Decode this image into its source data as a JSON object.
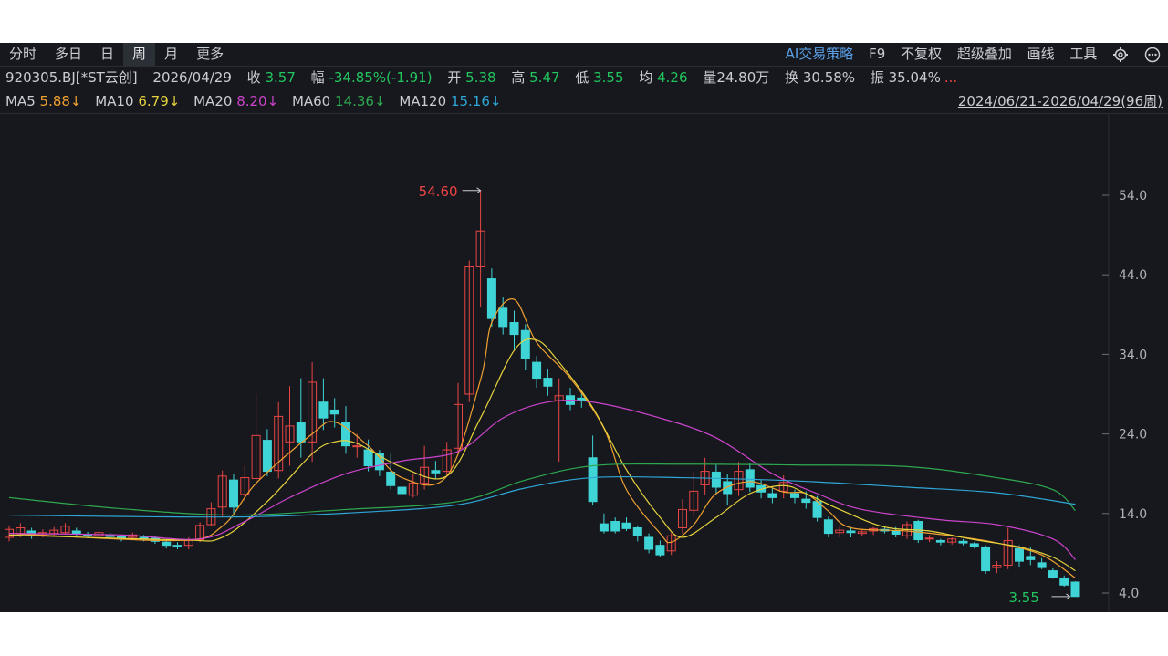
{
  "tabs": [
    "分时",
    "多日",
    "日",
    "周",
    "月",
    "更多"
  ],
  "active_tab": "周",
  "tools": {
    "ai": "AI交易策略",
    "f9": "F9",
    "fq": "不复权",
    "overlay": "超级叠加",
    "draw": "画线",
    "toolbox": "工具",
    "settings_icon": "gear-icon",
    "more_icon": "more-icon"
  },
  "stock": {
    "code": "920305.BJ[*ST云创]",
    "date": "2026/04/29",
    "close_label": "收",
    "close": "3.57",
    "chg_label": "幅",
    "chg": "-34.85%(-1.91)",
    "open_label": "开",
    "open": "5.38",
    "high_label": "高",
    "high": "5.47",
    "low_label": "低",
    "low": "3.55",
    "avg_label": "均",
    "avg": "4.26",
    "vol_label": "量",
    "vol": "24.80万",
    "turnover_label": "换",
    "turnover": "30.58%",
    "amp_label": "振",
    "amp": "35.04%",
    "more": "..."
  },
  "ma_bar": {
    "ma5_label": "MA5",
    "ma5": "5.88↓",
    "ma10_label": "MA10",
    "ma10": "6.79↓",
    "ma20_label": "MA20",
    "ma20": "8.20↓",
    "ma60_label": "MA60",
    "ma60": "14.36↓",
    "ma120_label": "MA120",
    "ma120": "15.16↓",
    "range": "2024/06/21-2026/04/29(96周)"
  },
  "colors": {
    "up": "#e84545",
    "down": "#3fd4d6",
    "ma5": "#f0a030",
    "ma10": "#e6d23c",
    "ma20": "#cc44cc",
    "ma60": "#2fa84f",
    "ma120": "#2fa6d6"
  },
  "chart_data": {
    "type": "candlestick",
    "ylim": [
      4.0,
      54.0
    ],
    "yticks": [
      "54.0",
      "44.0",
      "34.0",
      "24.0",
      "14.0",
      "4.0"
    ],
    "annotations": {
      "high": "54.60",
      "low": "3.55"
    },
    "candles": [
      [
        11.0,
        12.0,
        10.5,
        12.5
      ],
      [
        11.5,
        12.2,
        11.0,
        12.8
      ],
      [
        11.8,
        11.2,
        10.8,
        12.2
      ],
      [
        11.3,
        11.6,
        11.0,
        12.0
      ],
      [
        11.5,
        11.9,
        11.2,
        12.3
      ],
      [
        11.6,
        12.4,
        11.4,
        12.8
      ],
      [
        11.8,
        11.4,
        11.1,
        12.2
      ],
      [
        11.4,
        11.2,
        10.9,
        11.7
      ],
      [
        11.2,
        11.6,
        11.0,
        11.9
      ],
      [
        11.3,
        11.1,
        10.8,
        11.6
      ],
      [
        11.1,
        10.9,
        10.5,
        11.3
      ],
      [
        11.0,
        11.3,
        10.7,
        11.6
      ],
      [
        11.0,
        10.8,
        10.5,
        11.3
      ],
      [
        10.9,
        10.5,
        10.2,
        11.2
      ],
      [
        10.4,
        10.0,
        9.6,
        10.7
      ],
      [
        10.0,
        9.8,
        9.5,
        10.4
      ],
      [
        10.0,
        10.6,
        9.5,
        11.0
      ],
      [
        10.7,
        12.5,
        10.4,
        12.9
      ],
      [
        12.6,
        14.6,
        12.4,
        15.4
      ],
      [
        14.8,
        18.7,
        13.6,
        19.4
      ],
      [
        18.2,
        14.8,
        14.0,
        19.0
      ],
      [
        16.4,
        18.5,
        15.5,
        20.0
      ],
      [
        18.4,
        23.8,
        17.5,
        29.0
      ],
      [
        23.2,
        19.3,
        18.7,
        24.6
      ],
      [
        19.4,
        26.2,
        18.4,
        28.0
      ],
      [
        23.0,
        25.0,
        20.0,
        30.0
      ],
      [
        25.5,
        23.0,
        21.0,
        31.0
      ],
      [
        23.0,
        30.5,
        20.5,
        33.0
      ],
      [
        28.0,
        26.0,
        24.5,
        31.0
      ],
      [
        27.0,
        26.5,
        24.8,
        28.5
      ],
      [
        25.5,
        22.5,
        21.5,
        27.5
      ],
      [
        22.5,
        22.5,
        21.0,
        24.0
      ],
      [
        22.0,
        20.0,
        19.3,
        23.3
      ],
      [
        21.5,
        19.5,
        18.7,
        22.0
      ],
      [
        19.2,
        17.5,
        17.0,
        21.5
      ],
      [
        17.3,
        16.5,
        16.0,
        17.8
      ],
      [
        16.3,
        17.8,
        16.0,
        19.0
      ],
      [
        17.8,
        19.8,
        17.0,
        22.5
      ],
      [
        19.4,
        19.1,
        18.3,
        20.6
      ],
      [
        19.3,
        22.0,
        18.8,
        23.0
      ],
      [
        22.2,
        27.7,
        21.6,
        30.4
      ],
      [
        29.0,
        45.0,
        28.0,
        45.8
      ],
      [
        45.0,
        49.5,
        40.0,
        54.6
      ],
      [
        43.5,
        38.5,
        37.5,
        44.8
      ],
      [
        39.8,
        37.5,
        36.5,
        41.2
      ],
      [
        38.0,
        36.5,
        34.5,
        39.5
      ],
      [
        37.0,
        33.5,
        32.0,
        37.8
      ],
      [
        33.0,
        31.0,
        29.8,
        33.8
      ],
      [
        31.0,
        30.0,
        28.8,
        32.2
      ],
      [
        28.2,
        28.8,
        20.5,
        31.0
      ],
      [
        28.8,
        27.7,
        27.0,
        29.8
      ],
      [
        28.5,
        28.2,
        27.3,
        29.5
      ],
      [
        21.0,
        15.5,
        15.0,
        23.8
      ],
      [
        12.7,
        11.8,
        11.5,
        14.0
      ],
      [
        13.0,
        11.8,
        11.5,
        13.5
      ],
      [
        12.8,
        12.1,
        11.8,
        13.5
      ],
      [
        12.2,
        11.2,
        10.5,
        12.5
      ],
      [
        11.0,
        9.5,
        9.0,
        11.5
      ],
      [
        10.0,
        8.8,
        8.5,
        10.6
      ],
      [
        9.3,
        11.2,
        8.8,
        11.6
      ],
      [
        12.2,
        14.5,
        11.5,
        15.8
      ],
      [
        14.4,
        16.8,
        13.5,
        19.2
      ],
      [
        17.6,
        19.3,
        16.4,
        21.0
      ],
      [
        19.2,
        17.3,
        16.4,
        20.1
      ],
      [
        18.0,
        16.5,
        15.0,
        19.0
      ],
      [
        17.0,
        19.3,
        16.2,
        20.5
      ],
      [
        19.5,
        17.3,
        16.7,
        20.4
      ],
      [
        17.5,
        16.7,
        15.9,
        18.2
      ],
      [
        16.5,
        16.0,
        15.3,
        17.2
      ],
      [
        16.8,
        17.9,
        15.9,
        18.8
      ],
      [
        16.5,
        16.0,
        15.3,
        17.0
      ],
      [
        15.8,
        15.4,
        14.6,
        16.8
      ],
      [
        15.5,
        13.5,
        13.0,
        16.2
      ],
      [
        13.2,
        11.5,
        11.0,
        13.6
      ],
      [
        11.6,
        11.9,
        11.0,
        12.4
      ],
      [
        11.8,
        11.6,
        11.0,
        12.3
      ],
      [
        11.5,
        11.7,
        11.2,
        12.0
      ],
      [
        11.8,
        12.1,
        11.3,
        12.3
      ],
      [
        12.0,
        11.8,
        11.5,
        12.3
      ],
      [
        11.8,
        11.4,
        11.0,
        12.3
      ],
      [
        11.2,
        12.6,
        10.8,
        13.0
      ],
      [
        13.0,
        10.7,
        10.3,
        13.2
      ],
      [
        10.8,
        10.9,
        10.4,
        11.3
      ],
      [
        10.6,
        10.4,
        10.0,
        10.8
      ],
      [
        10.4,
        10.8,
        10.1,
        11.0
      ],
      [
        10.5,
        10.3,
        10.0,
        10.8
      ],
      [
        10.2,
        9.9,
        9.6,
        10.4
      ],
      [
        9.8,
        6.8,
        6.4,
        10.0
      ],
      [
        7.2,
        7.5,
        6.5,
        8.0
      ],
      [
        7.5,
        10.6,
        7.0,
        12.2
      ],
      [
        9.6,
        8.0,
        7.3,
        10.0
      ],
      [
        8.6,
        8.2,
        7.5,
        9.8
      ],
      [
        7.8,
        7.2,
        7.0,
        8.4
      ],
      [
        6.8,
        6.0,
        5.8,
        7.1
      ],
      [
        5.8,
        5.0,
        4.8,
        6.2
      ],
      [
        5.38,
        3.57,
        3.55,
        5.47
      ]
    ],
    "series": [
      {
        "name": "MA5",
        "anchors": [
          [
            0,
            11.5
          ],
          [
            15,
            10.6
          ],
          [
            19,
            12.4
          ],
          [
            22,
            17.8
          ],
          [
            27,
            24.0
          ],
          [
            29,
            25.5
          ],
          [
            32,
            22.5
          ],
          [
            35,
            18.5
          ],
          [
            39,
            18.7
          ],
          [
            42,
            30.8
          ],
          [
            43,
            38.0
          ],
          [
            45,
            40.9
          ],
          [
            47,
            35.5
          ],
          [
            50,
            31.0
          ],
          [
            53,
            24.7
          ],
          [
            55,
            17.0
          ],
          [
            58,
            11.5
          ],
          [
            59,
            10.4
          ],
          [
            61,
            12.6
          ],
          [
            63,
            16.5
          ],
          [
            66,
            18.0
          ],
          [
            69,
            16.7
          ],
          [
            71,
            16.5
          ],
          [
            73,
            14.3
          ],
          [
            75,
            12.2
          ],
          [
            80,
            11.8
          ],
          [
            85,
            11.0
          ],
          [
            88,
            10.3
          ],
          [
            92,
            8.8
          ],
          [
            95,
            5.88
          ]
        ]
      },
      {
        "name": "MA10",
        "anchors": [
          [
            0,
            11.3
          ],
          [
            15,
            10.7
          ],
          [
            19,
            11.0
          ],
          [
            23,
            15.5
          ],
          [
            27,
            21.5
          ],
          [
            29,
            23.0
          ],
          [
            31,
            22.8
          ],
          [
            35,
            19.8
          ],
          [
            39,
            18.7
          ],
          [
            42,
            26.0
          ],
          [
            45,
            34.5
          ],
          [
            47,
            35.8
          ],
          [
            49,
            33.0
          ],
          [
            52,
            27.3
          ],
          [
            55,
            19.5
          ],
          [
            58,
            13.5
          ],
          [
            60,
            11.0
          ],
          [
            63,
            13.5
          ],
          [
            66,
            16.5
          ],
          [
            69,
            17.5
          ],
          [
            71,
            16.5
          ],
          [
            74,
            14.5
          ],
          [
            78,
            12.3
          ],
          [
            82,
            11.8
          ],
          [
            86,
            10.7
          ],
          [
            90,
            9.8
          ],
          [
            93,
            8.5
          ],
          [
            95,
            6.79
          ]
        ]
      },
      {
        "name": "MA20",
        "anchors": [
          [
            0,
            11.5
          ],
          [
            10,
            11.3
          ],
          [
            17,
            10.8
          ],
          [
            21,
            13.0
          ],
          [
            25,
            16.0
          ],
          [
            30,
            19.0
          ],
          [
            35,
            20.6
          ],
          [
            40,
            21.8
          ],
          [
            44,
            26.0
          ],
          [
            48,
            28.0
          ],
          [
            52,
            28.0
          ],
          [
            58,
            26.0
          ],
          [
            63,
            23.5
          ],
          [
            68,
            19.0
          ],
          [
            72,
            16.5
          ],
          [
            76,
            14.5
          ],
          [
            83,
            13.2
          ],
          [
            88,
            12.6
          ],
          [
            93,
            10.8
          ],
          [
            95,
            8.2
          ]
        ]
      },
      {
        "name": "MA60",
        "anchors": [
          [
            0,
            16.0
          ],
          [
            10,
            14.6
          ],
          [
            20,
            13.8
          ],
          [
            30,
            14.5
          ],
          [
            40,
            15.5
          ],
          [
            46,
            18.2
          ],
          [
            52,
            20.0
          ],
          [
            60,
            20.2
          ],
          [
            70,
            20.1
          ],
          [
            80,
            19.9
          ],
          [
            88,
            18.5
          ],
          [
            93,
            17.0
          ],
          [
            95,
            14.36
          ]
        ]
      },
      {
        "name": "MA120",
        "anchors": [
          [
            0,
            13.8
          ],
          [
            12,
            13.6
          ],
          [
            22,
            13.6
          ],
          [
            32,
            14.2
          ],
          [
            40,
            15.1
          ],
          [
            46,
            17.2
          ],
          [
            52,
            18.5
          ],
          [
            60,
            18.5
          ],
          [
            70,
            18.1
          ],
          [
            80,
            17.3
          ],
          [
            88,
            16.6
          ],
          [
            95,
            15.16
          ]
        ]
      }
    ]
  }
}
